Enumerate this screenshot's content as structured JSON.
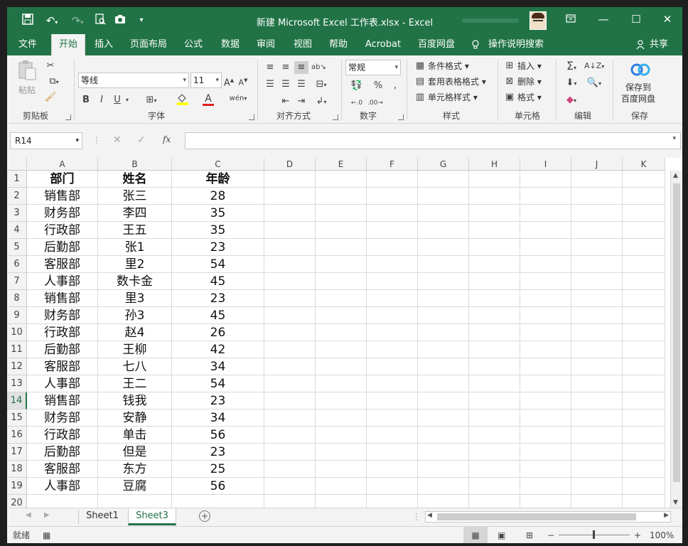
{
  "window": {
    "title": "新建 Microsoft Excel 工作表.xlsx  -  Excel"
  },
  "quick_access": {
    "save_icon": "save-icon",
    "undo_icon": "undo-icon",
    "redo_icon": "redo-icon",
    "preview_icon": "print-preview-icon",
    "camera_icon": "camera-icon"
  },
  "tabs": [
    "文件",
    "开始",
    "插入",
    "页面布局",
    "公式",
    "数据",
    "审阅",
    "视图",
    "帮助",
    "Acrobat",
    "百度网盘"
  ],
  "tell_me": "操作说明搜索",
  "share": "共享",
  "ribbon": {
    "clipboard": {
      "paste": "粘贴",
      "label": "剪贴板"
    },
    "font": {
      "name": "等线",
      "size": "11",
      "bold": "B",
      "italic": "I",
      "underline": "U",
      "label": "字体"
    },
    "alignment": {
      "label": "对齐方式"
    },
    "number": {
      "format": "常规",
      "label": "数字"
    },
    "styles": {
      "conditional": "条件格式",
      "table": "套用表格格式",
      "cell_styles": "单元格样式",
      "label": "样式"
    },
    "cells": {
      "insert": "插入",
      "delete": "删除",
      "format": "格式",
      "label": "单元格"
    },
    "editing": {
      "label": "编辑"
    },
    "save": {
      "line1": "保存到",
      "line2": "百度网盘",
      "label": "保存"
    }
  },
  "name_box": "R14",
  "columns": [
    "A",
    "B",
    "C",
    "D",
    "E",
    "F",
    "G",
    "H",
    "I",
    "J",
    "K"
  ],
  "rows": [
    [
      "部门",
      "姓名",
      "年龄"
    ],
    [
      "销售部",
      "张三",
      "28"
    ],
    [
      "财务部",
      "李四",
      "35"
    ],
    [
      "行政部",
      "王五",
      "35"
    ],
    [
      "后勤部",
      "张1",
      "23"
    ],
    [
      "客服部",
      "里2",
      "54"
    ],
    [
      "人事部",
      "数卡金",
      "45"
    ],
    [
      "销售部",
      "里3",
      "23"
    ],
    [
      "财务部",
      "孙3",
      "45"
    ],
    [
      "行政部",
      "赵4",
      "26"
    ],
    [
      "后勤部",
      "王柳",
      "42"
    ],
    [
      "客服部",
      "七八",
      "34"
    ],
    [
      "人事部",
      "王二",
      "54"
    ],
    [
      "销售部",
      "钱我",
      "23"
    ],
    [
      "财务部",
      "安静",
      "34"
    ],
    [
      "行政部",
      "单击",
      "56"
    ],
    [
      "后勤部",
      "但是",
      "23"
    ],
    [
      "客服部",
      "东方",
      "25"
    ],
    [
      "人事部",
      "豆腐",
      "56"
    ],
    [
      "",
      "",
      ""
    ]
  ],
  "row_numbers": [
    "1",
    "2",
    "3",
    "4",
    "5",
    "6",
    "7",
    "8",
    "9",
    "10",
    "11",
    "12",
    "13",
    "14",
    "15",
    "16",
    "17",
    "18",
    "19",
    "20"
  ],
  "selected_row": "14",
  "sheets": [
    "Sheet1",
    "Sheet3"
  ],
  "active_sheet": "Sheet3",
  "status": {
    "ready": "就绪",
    "zoom": "100%"
  },
  "colors": {
    "accent": "#217346"
  }
}
